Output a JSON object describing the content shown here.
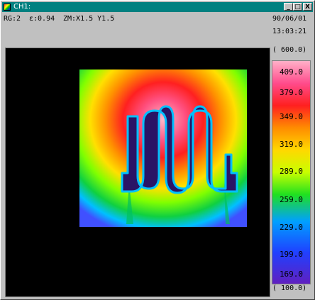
{
  "window": {
    "title": "CH1:",
    "min_label": "_",
    "max_label": "□",
    "close_label": "X"
  },
  "status": {
    "range": "RG:2",
    "emissivity": "ε:0.94",
    "zoom": "ZM:X1.5 Y1.5",
    "date": "90/06/01",
    "time": "13:03:21"
  },
  "scale": {
    "max_label": "( 600.0)",
    "min_label": "( 100.0)",
    "ticks": [
      "409.0",
      "379.0",
      "349.0",
      "319.0",
      "289.0",
      "259.0",
      "229.0",
      "199.0",
      "169.0"
    ],
    "colors": [
      "#ffb0c8",
      "#ff4c6c",
      "#ff8c00",
      "#ffd800",
      "#c8ff00",
      "#20e020",
      "#00a0ff",
      "#2040ff",
      "#6020c0"
    ]
  }
}
